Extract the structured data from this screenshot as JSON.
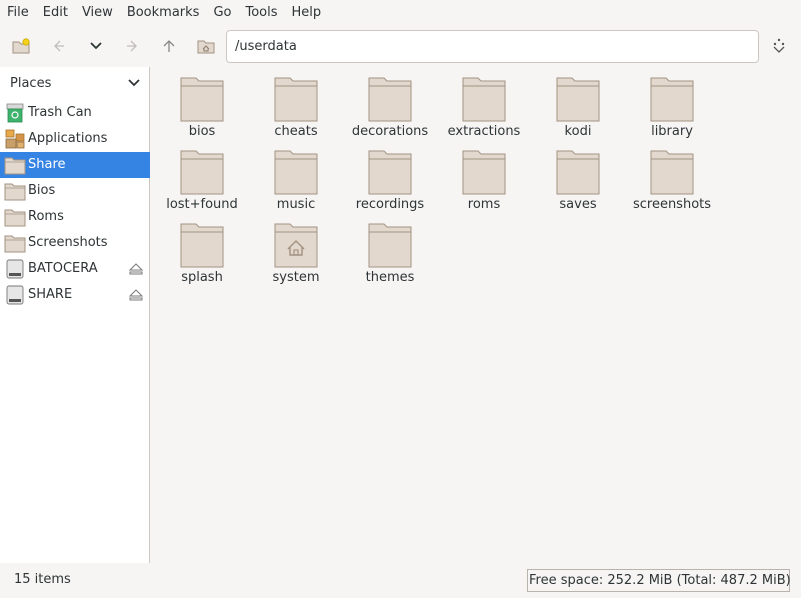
{
  "menubar": {
    "items": [
      "File",
      "Edit",
      "View",
      "Bookmarks",
      "Go",
      "Tools",
      "Help"
    ]
  },
  "toolbar": {
    "path": "/userdata",
    "icons": [
      "new-folder-icon",
      "back-icon",
      "history-dropdown-icon",
      "forward-icon",
      "up-icon",
      "home-icon",
      "compact-view-icon"
    ]
  },
  "sidebar": {
    "header": "Places",
    "items": [
      {
        "label": "Trash Can",
        "icon": "trash-can-icon"
      },
      {
        "label": "Applications",
        "icon": "applications-icon"
      },
      {
        "label": "Share",
        "icon": "folder-icon",
        "selected": true
      },
      {
        "label": "Bios",
        "icon": "folder-icon"
      },
      {
        "label": "Roms",
        "icon": "folder-icon"
      },
      {
        "label": "Screenshots",
        "icon": "folder-icon"
      },
      {
        "label": "BATOCERA",
        "icon": "drive-icon",
        "eject": true
      },
      {
        "label": "SHARE",
        "icon": "drive-icon",
        "eject": true
      }
    ]
  },
  "files": [
    {
      "name": "bios"
    },
    {
      "name": "cheats"
    },
    {
      "name": "decorations"
    },
    {
      "name": "extractions"
    },
    {
      "name": "kodi"
    },
    {
      "name": "library"
    },
    {
      "name": "lost+found"
    },
    {
      "name": "music"
    },
    {
      "name": "recordings"
    },
    {
      "name": "roms"
    },
    {
      "name": "saves"
    },
    {
      "name": "screenshots"
    },
    {
      "name": "splash"
    },
    {
      "name": "system",
      "home": true
    },
    {
      "name": "themes"
    }
  ],
  "status": {
    "item_count": "15 items",
    "free_space": "Free space: 252.2 MiB (Total: 487.2 MiB)"
  },
  "colors": {
    "selection": "#3584e4",
    "folder_fill": "#e2d8ce",
    "folder_stroke": "#a39382"
  }
}
